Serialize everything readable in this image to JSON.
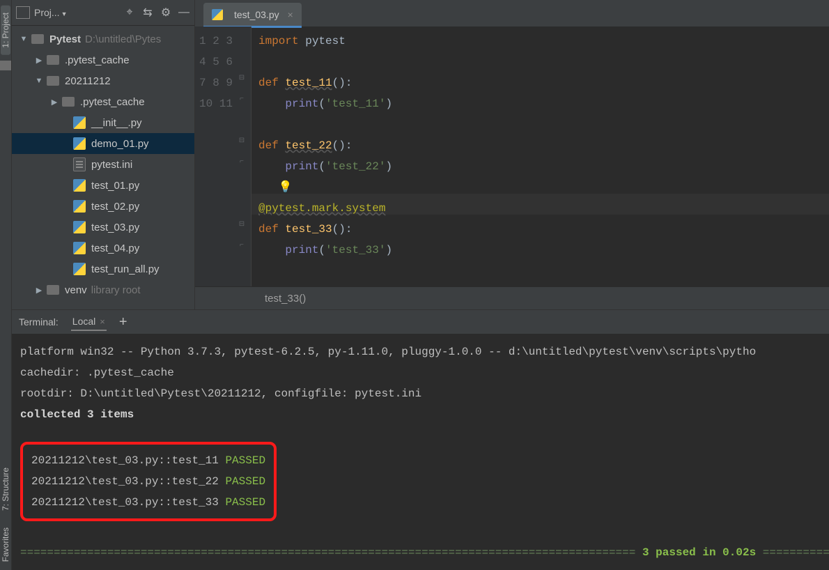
{
  "sidebar_tabs": {
    "project": "1: Project",
    "structure": "7: Structure",
    "favorites": "Favorites"
  },
  "project_header": {
    "title": "Proj..."
  },
  "tree": {
    "root": {
      "name": "Pytest",
      "hint": "D:\\untitled\\Pytes"
    },
    "cache1": ".pytest_cache",
    "folder2": "20211212",
    "cache2": ".pytest_cache",
    "files": {
      "init": "__init__.py",
      "demo": "demo_01.py",
      "ini": "pytest.ini",
      "t01": "test_01.py",
      "t02": "test_02.py",
      "t03": "test_03.py",
      "t04": "test_04.py",
      "trun": "test_run_all.py"
    },
    "venv": {
      "name": "venv",
      "hint": "library root"
    }
  },
  "editor": {
    "tab": "test_03.py",
    "lines": {
      "l1_kw": "import",
      "l1_rest": " pytest",
      "l3_kw": "def ",
      "l3_fn": "test_11",
      "l3_rest": "():",
      "l4_fn": "print",
      "l4_p1": "(",
      "l4_str": "'test_11'",
      "l4_p2": ")",
      "l6_kw": "def ",
      "l6_fn": "test_22",
      "l6_rest": "():",
      "l7_fn": "print",
      "l7_p1": "(",
      "l7_str": "'test_22'",
      "l7_p2": ")",
      "l9_dec": "@pytest.mark.system",
      "l10_kw": "def ",
      "l10_fn": "test_33",
      "l10_rest": "():",
      "l11_fn": "print",
      "l11_p1": "(",
      "l11_str": "'test_33'",
      "l11_p2": ")"
    },
    "breadcrumb": "test_33()"
  },
  "terminal": {
    "header": {
      "title": "Terminal:",
      "tab": "Local"
    },
    "line1": "platform win32 -- Python 3.7.3, pytest-6.2.5, py-1.11.0, pluggy-1.0.0 -- d:\\untitled\\pytest\\venv\\scripts\\pytho",
    "line2": "cachedir: .pytest_cache",
    "line3": "rootdir: D:\\untitled\\Pytest\\20211212, configfile: pytest.ini",
    "line4": "collected 3 items",
    "r1a": "20211212\\test_03.py::test_11 ",
    "r1b": "PASSED",
    "r2a": "20211212\\test_03.py::test_22 ",
    "r2b": "PASSED",
    "r3a": "20211212\\test_03.py::test_33 ",
    "r3b": "PASSED",
    "sum_bar1": "============================================================================================ ",
    "sum_mid": "3 passed in 0.02s",
    "sum_bar2": " =============="
  }
}
